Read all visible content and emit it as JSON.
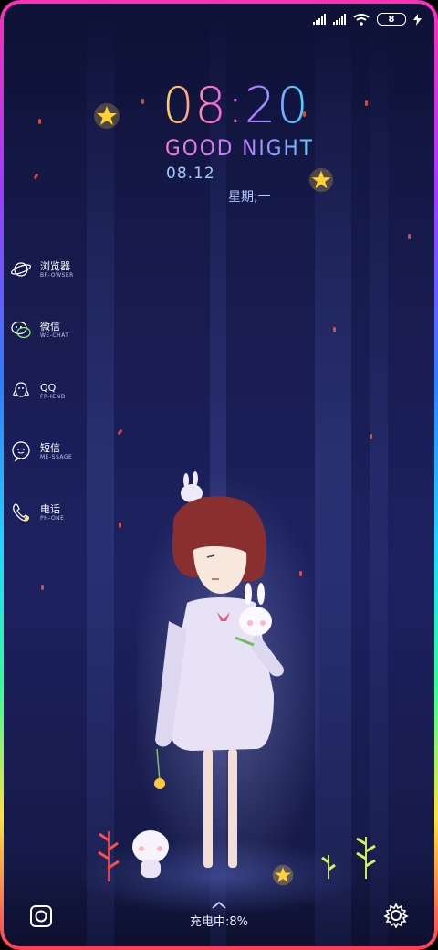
{
  "status": {
    "battery_level": "8",
    "icons": [
      "signal-icon",
      "signal-icon",
      "wifi-icon",
      "battery-icon",
      "charging-icon"
    ]
  },
  "clock": {
    "time": "08:20",
    "greeting": "GOOD NIGHT",
    "date": "08.12",
    "weekday": "星期,一"
  },
  "apps": [
    {
      "title": "浏览器",
      "subtitle": "BR-OWSER",
      "icon": "browser-planet-icon"
    },
    {
      "title": "微信",
      "subtitle": "WE-CHAT",
      "icon": "wechat-icon"
    },
    {
      "title": "QQ",
      "subtitle": "FR-IEND",
      "icon": "qq-penguin-icon"
    },
    {
      "title": "短信",
      "subtitle": "ME-SSAGE",
      "icon": "message-icon"
    },
    {
      "title": "电话",
      "subtitle": "PH-ONE",
      "icon": "phone-icon"
    }
  ],
  "bottom": {
    "charging_text": "充电中:8%",
    "left_icon": "camera-icon",
    "right_icon": "settings-gear-icon",
    "swipe_icon": "chevron-up-icon"
  },
  "colors": {
    "background": "#161a4a",
    "border_top": "#ff2fb4",
    "border_bottom": "#ffe23b",
    "star": "#ffd23a"
  }
}
